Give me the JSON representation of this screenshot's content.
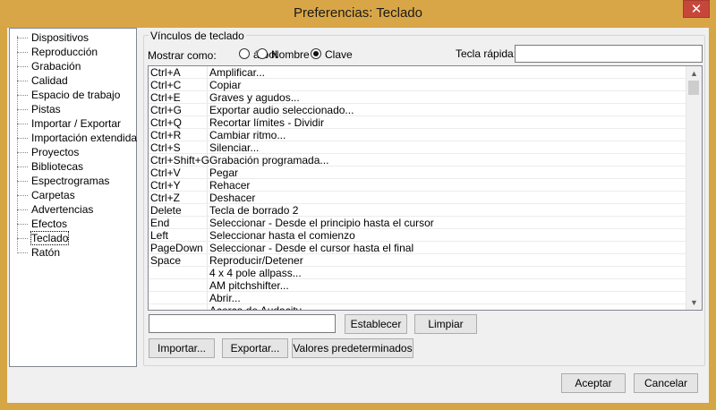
{
  "window": {
    "title": "Preferencias: Teclado",
    "close_glyph": "✕"
  },
  "sidebar": {
    "items": [
      "Dispositivos",
      "Reproducción",
      "Grabación",
      "Calidad",
      "Espacio de trabajo",
      "Pistas",
      "Importar / Exportar",
      "Importación extendida",
      "Proyectos",
      "Bibliotecas",
      "Espectrogramas",
      "Carpetas",
      "Advertencias",
      "Efectos",
      "Teclado",
      "Ratón"
    ],
    "selected": "Teclado"
  },
  "group": {
    "label": "Vínculos de teclado"
  },
  "view_mode": {
    "label": "Mostrar como:",
    "options": [
      {
        "label": "árbol",
        "checked": false
      },
      {
        "label": "Nombre",
        "checked": false
      },
      {
        "label": "Clave",
        "checked": true
      }
    ]
  },
  "hotkey": {
    "label": "Tecla rápida:",
    "value": ""
  },
  "bindings": [
    {
      "key": "Ctrl+A",
      "command": "Amplificar..."
    },
    {
      "key": "Ctrl+C",
      "command": "Copiar"
    },
    {
      "key": "Ctrl+E",
      "command": "Graves y agudos..."
    },
    {
      "key": "Ctrl+G",
      "command": "Exportar audio seleccionado..."
    },
    {
      "key": "Ctrl+Q",
      "command": "Recortar límites - Dividir"
    },
    {
      "key": "Ctrl+R",
      "command": "Cambiar ritmo..."
    },
    {
      "key": "Ctrl+S",
      "command": "Silenciar..."
    },
    {
      "key": "Ctrl+Shift+G",
      "command": "Grabación programada..."
    },
    {
      "key": "Ctrl+V",
      "command": "Pegar"
    },
    {
      "key": "Ctrl+Y",
      "command": "Rehacer"
    },
    {
      "key": "Ctrl+Z",
      "command": "Deshacer"
    },
    {
      "key": "Delete",
      "command": "Tecla de borrado 2"
    },
    {
      "key": "End",
      "command": "Seleccionar - Desde el principio hasta el cursor"
    },
    {
      "key": "Left",
      "command": "Seleccionar hasta el comienzo"
    },
    {
      "key": "PageDown",
      "command": "Seleccionar - Desde el cursor hasta el final"
    },
    {
      "key": "Space",
      "command": "Reproducir/Detener"
    },
    {
      "key": "",
      "command": "4 x 4 pole allpass..."
    },
    {
      "key": "",
      "command": "AM pitchshifter..."
    },
    {
      "key": "",
      "command": "Abrir..."
    },
    {
      "key": "",
      "command": "Acerca de Audacity..."
    }
  ],
  "edit": {
    "value": "",
    "set_label": "Establecer",
    "clear_label": "Limpiar"
  },
  "actions": {
    "import_label": "Importar...",
    "export_label": "Exportar...",
    "defaults_label": "Valores predeterminados"
  },
  "footer": {
    "ok_label": "Aceptar",
    "cancel_label": "Cancelar"
  },
  "scrollbar": {
    "up_glyph": "▲",
    "down_glyph": "▼"
  },
  "colors": {
    "title_bar": "#d9a647",
    "close": "#c7463a",
    "selection": "#000000"
  }
}
